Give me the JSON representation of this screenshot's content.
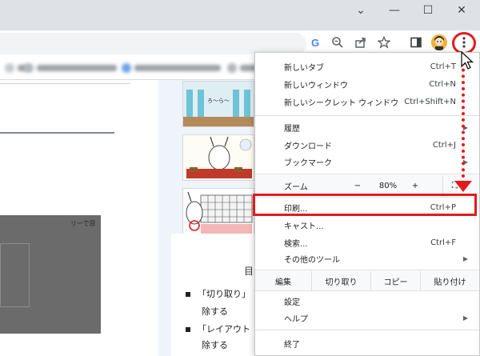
{
  "window": {
    "minimize_glyph": "—",
    "maximize_glyph": "☐",
    "close_glyph": "✕",
    "tabs_dropdown_glyph": "⌄"
  },
  "toolbar": {
    "icons": [
      "google-g-icon",
      "zoom-icon",
      "share-icon",
      "bookmark-star-icon",
      "side-panel-icon",
      "profile-avatar-icon",
      "kebab-menu-icon"
    ]
  },
  "page": {
    "gray_caption": "リーで目",
    "toc_heading": "目",
    "bullets": [
      {
        "text": "「切り取り」",
        "sub": "除する"
      },
      {
        "text": "「レイアウト",
        "sub": "除する"
      }
    ],
    "thumb_caption": "ろ〜ら〜"
  },
  "menu": {
    "items_top": [
      {
        "label": "新しいタブ",
        "shortcut": "Ctrl+T"
      },
      {
        "label": "新しいウィンドウ",
        "shortcut": "Ctrl+N"
      },
      {
        "label": "新しいシークレット ウィンドウ",
        "shortcut": "Ctrl+Shift+N"
      }
    ],
    "items_history": [
      {
        "label": "履歴",
        "shortcut": ""
      },
      {
        "label": "ダウンロード",
        "shortcut": "Ctrl+J"
      },
      {
        "label": "ブックマーク",
        "shortcut": ""
      }
    ],
    "zoom": {
      "label": "ズーム",
      "minus": "−",
      "value": "80%",
      "plus": "+",
      "fullscreen": "⛶"
    },
    "items_print": [
      {
        "label": "印刷...",
        "shortcut": "Ctrl+P"
      },
      {
        "label": "キャスト...",
        "shortcut": ""
      },
      {
        "label": "検索...",
        "shortcut": "Ctrl+F"
      },
      {
        "label": "その他のツール",
        "shortcut": ""
      }
    ],
    "edit": {
      "label": "編集",
      "cut": "切り取り",
      "copy": "コピー",
      "paste": "貼り付け"
    },
    "items_settings": [
      {
        "label": "設定",
        "shortcut": ""
      },
      {
        "label": "ヘルプ",
        "shortcut": ""
      }
    ],
    "exit": {
      "label": "終了"
    }
  },
  "colors": {
    "highlight_red": "#e11b1b",
    "titlebar": "#dee1e6"
  }
}
